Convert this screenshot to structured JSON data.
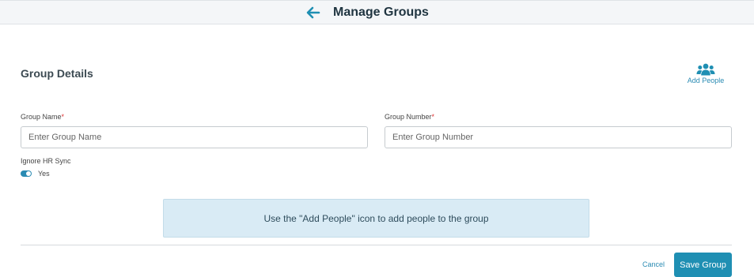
{
  "header": {
    "title": "Manage Groups",
    "back_icon": "arrow-left-icon"
  },
  "group_details": {
    "title": "Group Details",
    "add_people": {
      "icon": "people-group-icon",
      "label": "Add People"
    },
    "group_name": {
      "label": "Group Name",
      "required_mark": "*",
      "placeholder": "Enter Group Name",
      "value": ""
    },
    "group_number": {
      "label": "Group Number",
      "required_mark": "*",
      "placeholder": "Enter Group Number",
      "value": ""
    },
    "ignore_hr_sync": {
      "label": "Ignore HR Sync",
      "state": "on",
      "value_label": "Yes"
    },
    "info_message": "Use the \"Add People\" icon to add people to the group"
  },
  "footer": {
    "cancel_label": "Cancel",
    "save_label": "Save Group"
  },
  "colors": {
    "accent": "#1f8fb3",
    "info_bg": "#d9ebf5",
    "required": "#dd3333"
  }
}
